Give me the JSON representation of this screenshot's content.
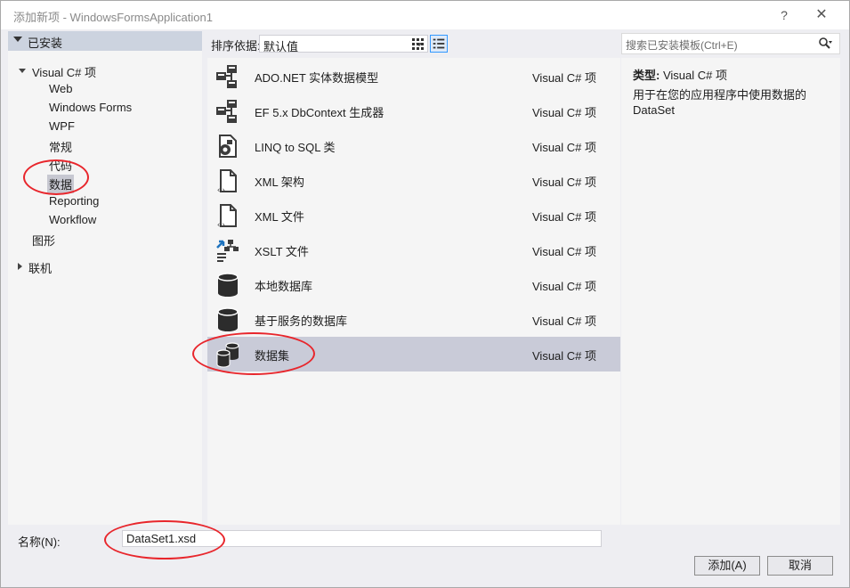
{
  "window": {
    "title": "添加新项 - WindowsFormsApplication1",
    "help": "?",
    "close": "✕"
  },
  "sidebar": {
    "installed": "已安装",
    "root": "Visual C# 项",
    "children": [
      "Web",
      "Windows Forms",
      "WPF",
      "常规",
      "代码",
      "数据",
      "Reporting",
      "Workflow"
    ],
    "graphics": "图形",
    "online": "联机",
    "selected": "数据"
  },
  "toolbar": {
    "sort_label": "排序依据:",
    "sort_value": "默认值"
  },
  "search": {
    "placeholder": "搜索已安装模板(Ctrl+E)"
  },
  "templates": [
    {
      "name": "ADO.NET 实体数据模型",
      "type": "Visual C# 项",
      "icon": "entity-model-icon"
    },
    {
      "name": "EF 5.x DbContext 生成器",
      "type": "Visual C# 项",
      "icon": "dbcontext-generator-icon"
    },
    {
      "name": "LINQ to SQL 类",
      "type": "Visual C# 项",
      "icon": "linq-to-sql-icon"
    },
    {
      "name": "XML 架构",
      "type": "Visual C# 项",
      "icon": "xml-schema-icon"
    },
    {
      "name": "XML 文件",
      "type": "Visual C# 项",
      "icon": "xml-file-icon"
    },
    {
      "name": "XSLT 文件",
      "type": "Visual C# 项",
      "icon": "xslt-file-icon"
    },
    {
      "name": "本地数据库",
      "type": "Visual C# 项",
      "icon": "local-database-icon"
    },
    {
      "name": "基于服务的数据库",
      "type": "Visual C# 项",
      "icon": "service-database-icon"
    },
    {
      "name": "数据集",
      "type": "Visual C# 项",
      "icon": "dataset-icon",
      "selected": true
    }
  ],
  "detail": {
    "type_label": "类型:",
    "type_value": "Visual C# 项",
    "description": "用于在您的应用程序中使用数据的 DataSet"
  },
  "footer": {
    "name_label": "名称(N):",
    "name_value": "DataSet1.xsd",
    "add_button": "添加(A)",
    "cancel_button": "取消"
  },
  "colors": {
    "selection": "#c9cbd8",
    "annotation": "#e8262c",
    "header": "#ccd3df"
  }
}
